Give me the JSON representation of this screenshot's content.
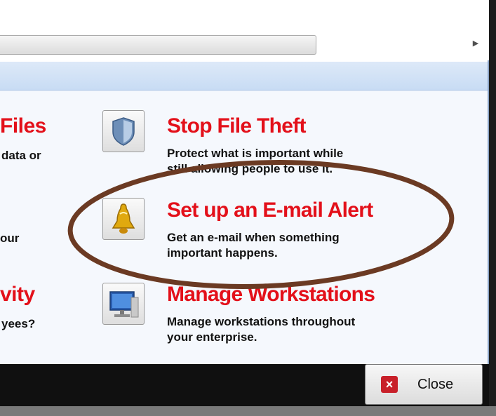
{
  "hscroll": {
    "arrow_glyph": "▶"
  },
  "left_column": {
    "files_title": "Files",
    "files_desc": "data or",
    "line_text": "our",
    "activity_title": "vity",
    "activity_desc": "yees?"
  },
  "items": [
    {
      "title": "Stop File Theft",
      "desc_line1": "Protect what is important while",
      "desc_line2": "still allowing people to use it.",
      "icon": "shield-icon"
    },
    {
      "title": "Set up an E-mail Alert",
      "desc_line1": "Get an e-mail when something",
      "desc_line2": "important happens.",
      "icon": "bell-icon"
    },
    {
      "title": "Manage Workstations",
      "desc_line1": "Manage workstations throughout",
      "desc_line2": "your enterprise.",
      "icon": "monitor-icon"
    }
  ],
  "footer": {
    "close_label": "Close",
    "close_glyph": "×"
  },
  "colors": {
    "title_red": "#e3101a",
    "annotation_brown": "#6b3a23"
  }
}
